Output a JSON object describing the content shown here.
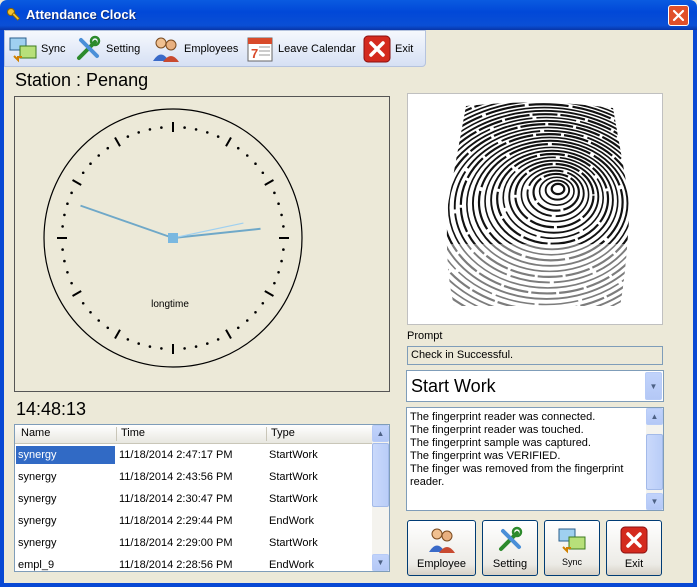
{
  "window": {
    "title": "Attendance Clock",
    "icon": "key-icon"
  },
  "toolbar": {
    "sync_label": "Sync",
    "setting_label": "Setting",
    "employees_label": "Employees",
    "leave_calendar_label": "Leave Calendar",
    "exit_label": "Exit"
  },
  "station": {
    "label": "Station : Penang"
  },
  "clock": {
    "caption": "longtime",
    "hours": 14,
    "minutes": 48,
    "seconds": 13
  },
  "digital_time": "14:48:13",
  "list": {
    "columns": [
      "Name",
      "Time",
      "Type"
    ],
    "rows": [
      {
        "name": "synergy",
        "time": "11/18/2014 2:47:17 PM",
        "type": "StartWork"
      },
      {
        "name": "synergy",
        "time": "11/18/2014 2:43:56 PM",
        "type": "StartWork"
      },
      {
        "name": "synergy",
        "time": "11/18/2014 2:30:47 PM",
        "type": "StartWork"
      },
      {
        "name": "synergy",
        "time": "11/18/2014 2:29:44 PM",
        "type": "EndWork"
      },
      {
        "name": "synergy",
        "time": "11/18/2014 2:29:00 PM",
        "type": "StartWork"
      },
      {
        "name": "empl_9",
        "time": "11/18/2014 2:28:56 PM",
        "type": "EndWork"
      }
    ]
  },
  "prompt": {
    "label": "Prompt",
    "value": "Check in Successful."
  },
  "work_type": {
    "selected": "Start Work"
  },
  "log": {
    "lines": [
      "The fingerprint reader was connected.",
      "The fingerprint reader was touched.",
      "The fingerprint sample was captured.",
      "The fingerprint was VERIFIED.",
      "The finger was removed from the fingerprint reader."
    ]
  },
  "buttons": {
    "employee_label": "Employee",
    "setting_label": "Setting",
    "sync_label": "Sync",
    "exit_label": "Exit"
  }
}
